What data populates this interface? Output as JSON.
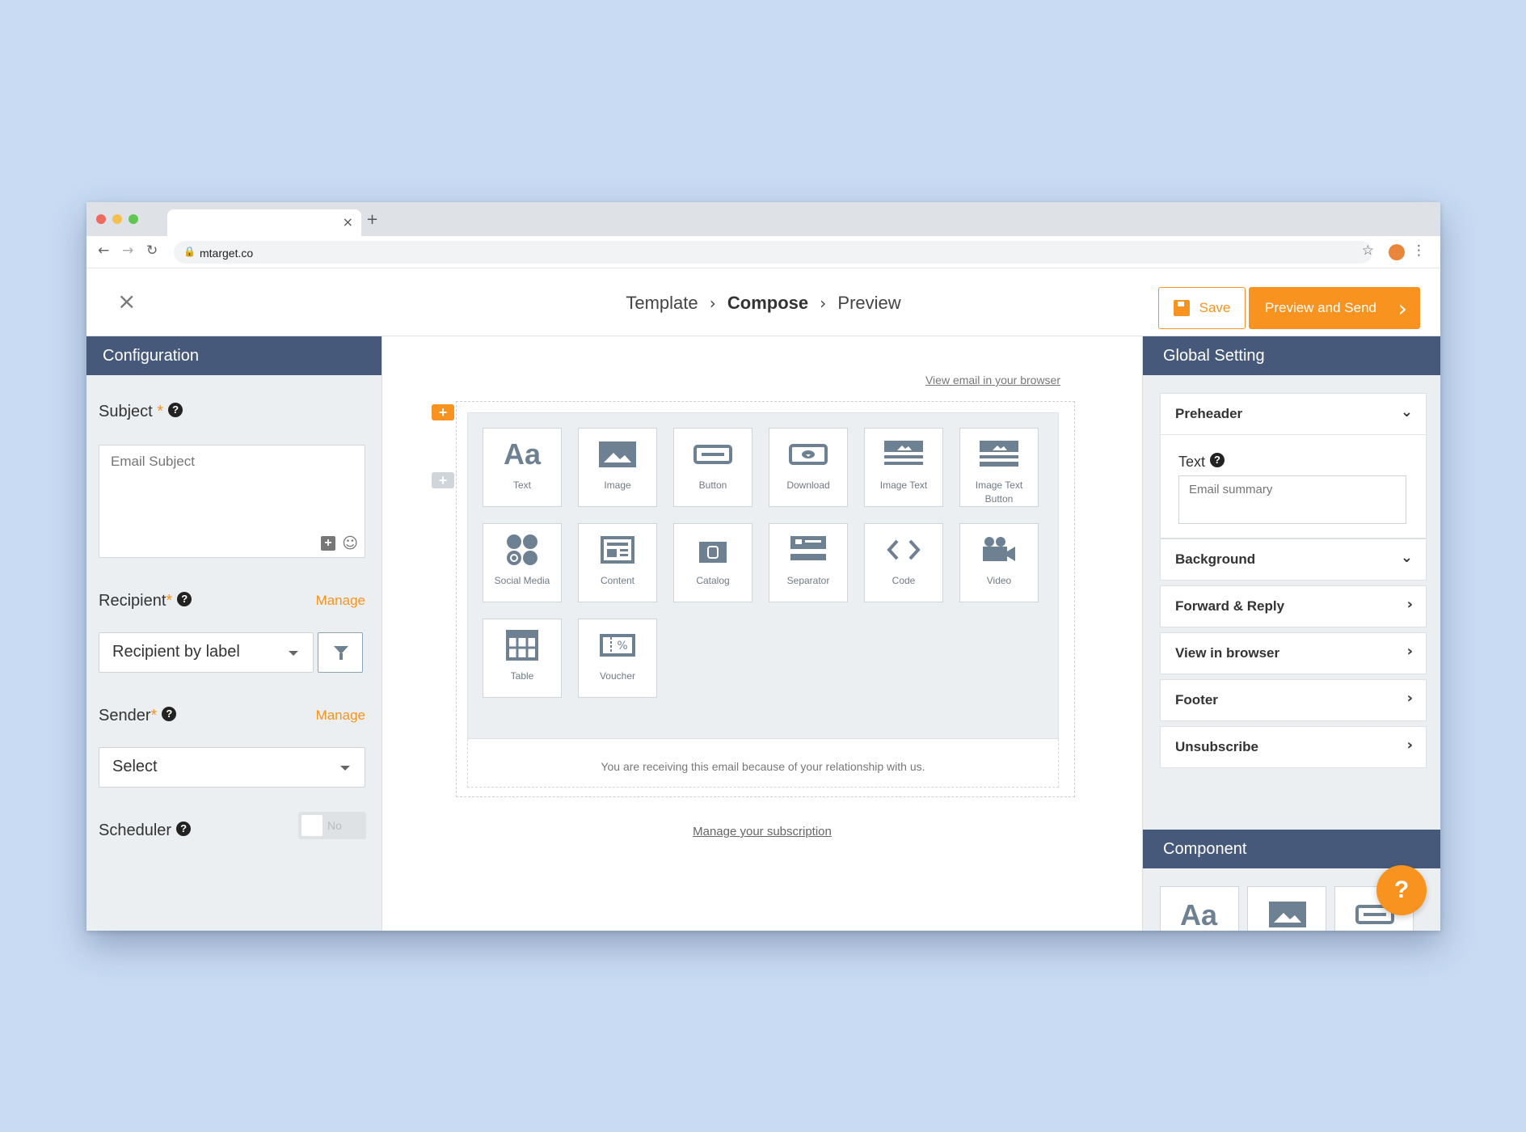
{
  "browser": {
    "url": "mtarget.co",
    "tab_close": "×",
    "new_tab": "+"
  },
  "header": {
    "close_icon": "×",
    "breadcrumb": {
      "step1": "Template",
      "step2": "Compose",
      "step3": "Preview",
      "separator": "›"
    },
    "save_label": "Save",
    "send_label": "Preview and Send"
  },
  "config": {
    "title": "Configuration",
    "subject_label": "Subject",
    "subject_placeholder": "Email Subject",
    "recipient_label": "Recipient",
    "recipient_manage": "Manage",
    "recipient_value": "Recipient by label",
    "sender_label": "Sender",
    "sender_manage": "Manage",
    "sender_value": "Select",
    "scheduler_label": "Scheduler",
    "scheduler_toggle": "No",
    "required_mark": "*",
    "help_mark": "?"
  },
  "canvas": {
    "view_in_browser": "View email in your browser",
    "blocks": [
      "Text",
      "Image",
      "Button",
      "Download",
      "Image Text",
      "Image Text Button",
      "Social Media",
      "Content",
      "Catalog",
      "Separator",
      "Code",
      "Video",
      "Table",
      "Voucher"
    ],
    "footer_note": "You are receiving this email because of your relationship with us.",
    "manage_subscription": "Manage your subscription"
  },
  "global": {
    "title": "Global Setting",
    "preheader": "Preheader",
    "text_label": "Text",
    "text_placeholder": "Email summary",
    "sections": [
      "Background",
      "Forward & Reply",
      "View in browser",
      "Footer",
      "Unsubscribe"
    ],
    "component_title": "Component",
    "help_button": "?"
  },
  "colors": {
    "accent": "#f7931e",
    "panel_header": "#47597a",
    "panel_bg": "#eceff1",
    "icon_gray": "#6e8192"
  }
}
